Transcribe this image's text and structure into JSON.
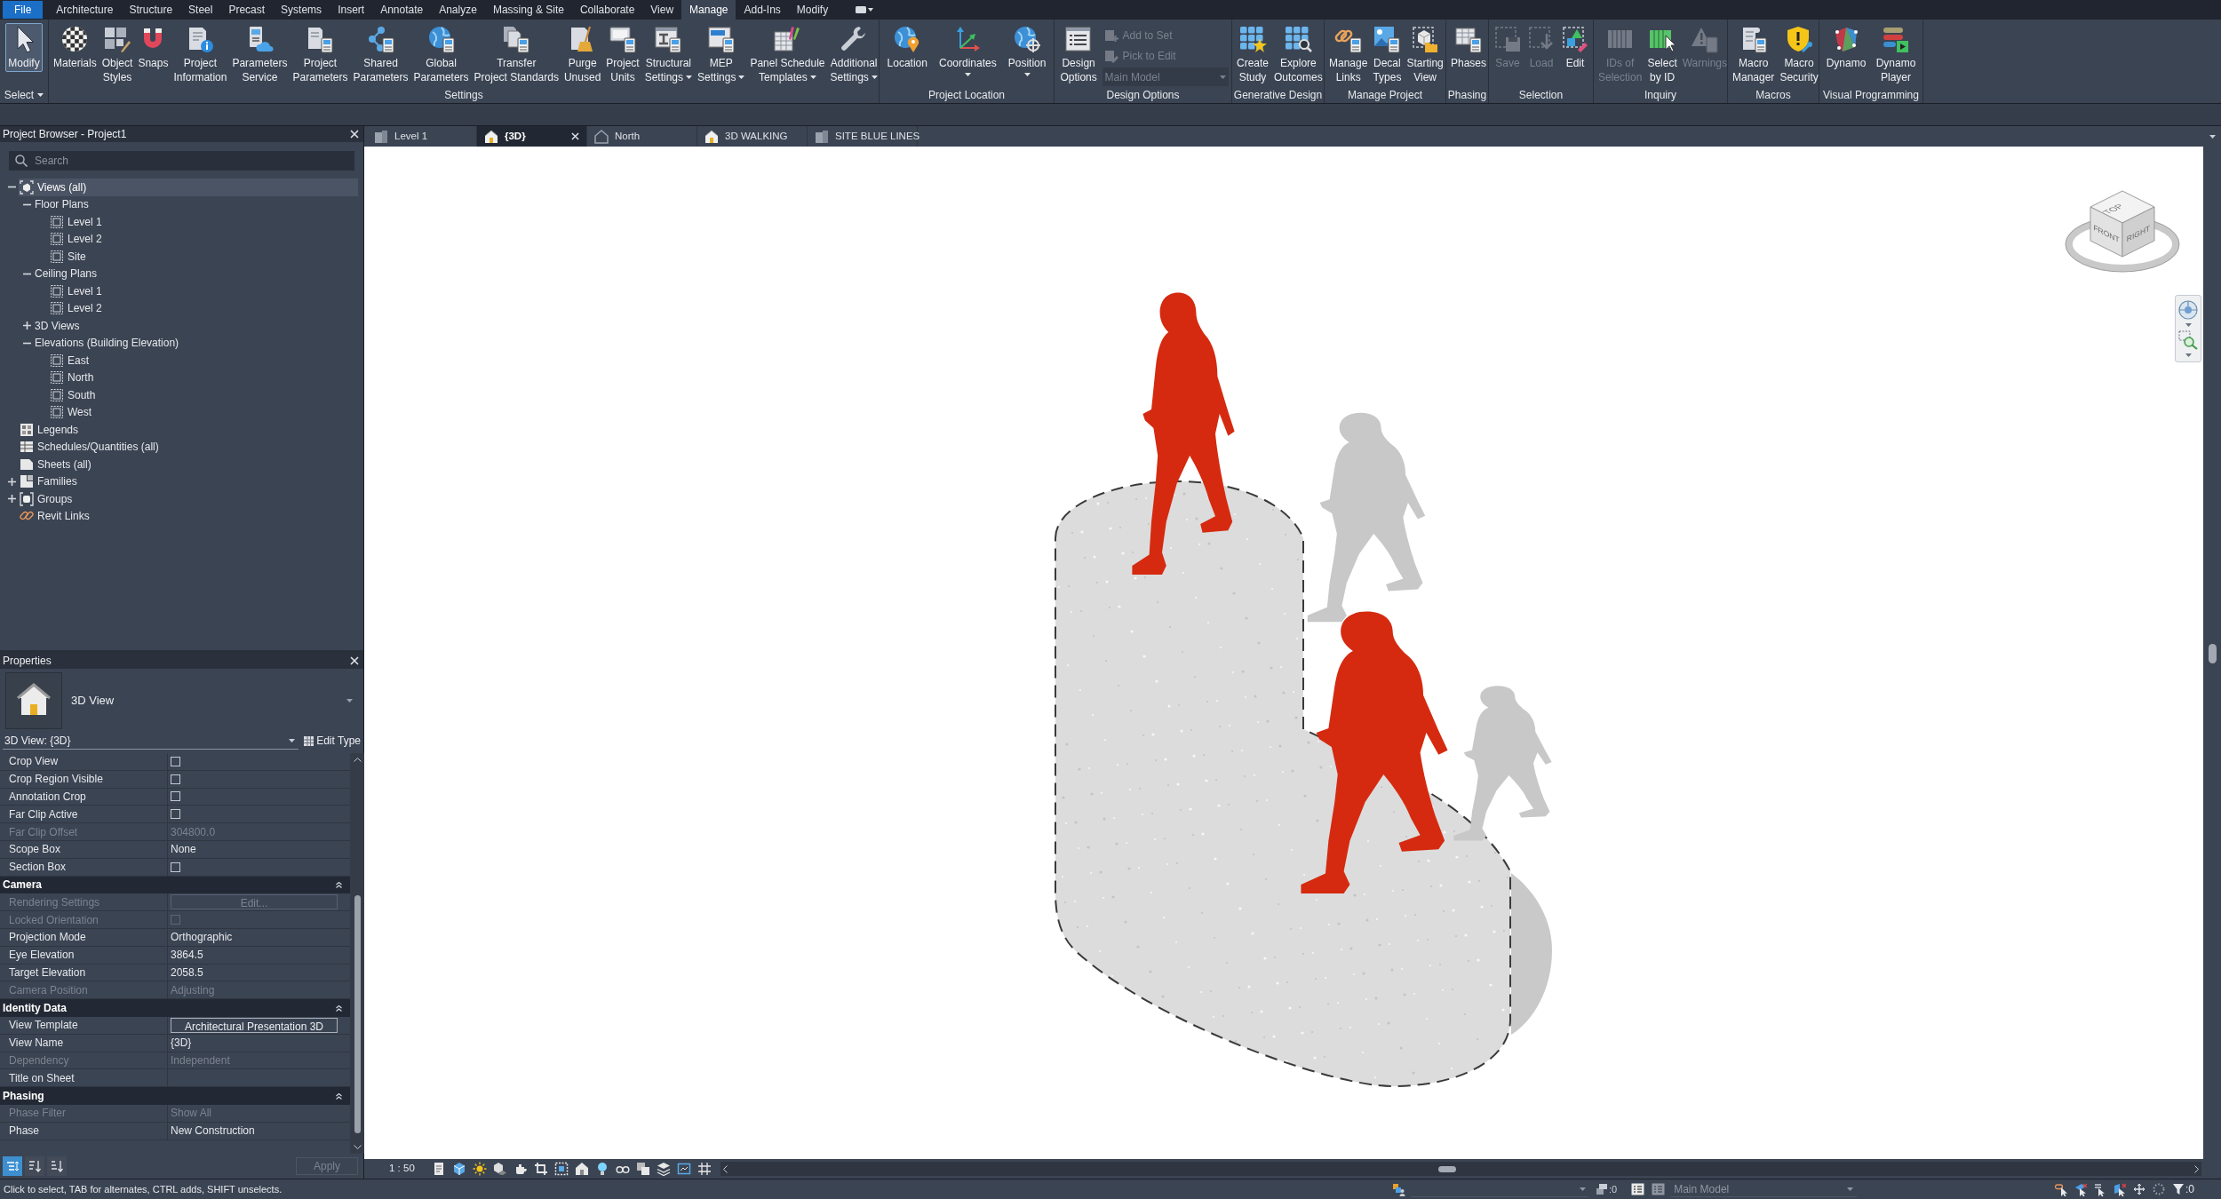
{
  "ribbon": {
    "tabs": [
      {
        "label": "File",
        "kind": "file",
        "selected": false
      },
      {
        "label": "Architecture",
        "kind": "tab",
        "selected": false
      },
      {
        "label": "Structure",
        "kind": "tab",
        "selected": false
      },
      {
        "label": "Steel",
        "kind": "tab",
        "selected": false
      },
      {
        "label": "Precast",
        "kind": "tab",
        "selected": false
      },
      {
        "label": "Systems",
        "kind": "tab",
        "selected": false
      },
      {
        "label": "Insert",
        "kind": "tab",
        "selected": false
      },
      {
        "label": "Annotate",
        "kind": "tab",
        "selected": false
      },
      {
        "label": "Analyze",
        "kind": "tab",
        "selected": false
      },
      {
        "label": "Massing & Site",
        "kind": "tab",
        "selected": false
      },
      {
        "label": "Collaborate",
        "kind": "tab",
        "selected": false
      },
      {
        "label": "View",
        "kind": "tab",
        "selected": false
      },
      {
        "label": "Manage",
        "kind": "tab",
        "selected": true
      },
      {
        "label": "Add-Ins",
        "kind": "tab",
        "selected": false
      },
      {
        "label": "Modify",
        "kind": "tab",
        "selected": false
      }
    ],
    "panels": [
      {
        "label": "Select",
        "dropdown": true,
        "tools": [
          {
            "kind": "large",
            "label_lines": [
              "Modify"
            ],
            "active": true,
            "disabled": false,
            "dropdown": false
          }
        ]
      },
      {
        "label": "Settings",
        "dropdown": false,
        "tools": [
          {
            "kind": "large",
            "label_lines": [
              "Materials"
            ],
            "active": false,
            "disabled": false,
            "dropdown": false
          },
          {
            "kind": "large",
            "label_lines": [
              "Object",
              "Styles"
            ],
            "active": false,
            "disabled": false,
            "dropdown": false
          },
          {
            "kind": "large",
            "label_lines": [
              "Snaps"
            ],
            "active": false,
            "disabled": false,
            "dropdown": false
          },
          {
            "kind": "large",
            "label_lines": [
              "Project",
              "Information"
            ],
            "active": false,
            "disabled": false,
            "dropdown": false
          },
          {
            "kind": "large",
            "label_lines": [
              "Parameters",
              "Service"
            ],
            "active": false,
            "disabled": false,
            "dropdown": false
          },
          {
            "kind": "large",
            "label_lines": [
              "Project",
              "Parameters"
            ],
            "active": false,
            "disabled": false,
            "dropdown": false
          },
          {
            "kind": "large",
            "label_lines": [
              "Shared",
              "Parameters"
            ],
            "active": false,
            "disabled": false,
            "dropdown": false
          },
          {
            "kind": "large",
            "label_lines": [
              "Global",
              "Parameters"
            ],
            "active": false,
            "disabled": false,
            "dropdown": false
          },
          {
            "kind": "large",
            "label_lines": [
              "Transfer",
              "Project Standards"
            ],
            "active": false,
            "disabled": false,
            "dropdown": false
          },
          {
            "kind": "large",
            "label_lines": [
              "Purge",
              "Unused"
            ],
            "active": false,
            "disabled": false,
            "dropdown": false
          },
          {
            "kind": "large",
            "label_lines": [
              "Project",
              "Units"
            ],
            "active": false,
            "disabled": false,
            "dropdown": false
          },
          {
            "kind": "large",
            "label_lines": [
              "Structural",
              "Settings"
            ],
            "active": false,
            "disabled": false,
            "dropdown": true
          },
          {
            "kind": "large",
            "label_lines": [
              "MEP",
              "Settings"
            ],
            "active": false,
            "disabled": false,
            "dropdown": true
          },
          {
            "kind": "large",
            "label_lines": [
              "Panel Schedule",
              "Templates"
            ],
            "active": false,
            "disabled": false,
            "dropdown": true
          },
          {
            "kind": "large",
            "label_lines": [
              "Additional",
              "Settings"
            ],
            "active": false,
            "disabled": false,
            "dropdown": true
          }
        ]
      },
      {
        "label": "Project Location",
        "dropdown": false,
        "tools": [
          {
            "kind": "large",
            "label_lines": [
              "Location"
            ],
            "active": false,
            "disabled": false,
            "dropdown": false
          },
          {
            "kind": "large",
            "label_lines": [
              "Coordinates"
            ],
            "active": false,
            "disabled": false,
            "dropdown": true
          },
          {
            "kind": "large",
            "label_lines": [
              "Position"
            ],
            "active": false,
            "disabled": false,
            "dropdown": true
          }
        ]
      },
      {
        "label": "Design Options",
        "dropdown": false,
        "tools": [
          {
            "kind": "large",
            "label_lines": [
              "Design",
              "Options"
            ],
            "active": false,
            "disabled": false,
            "dropdown": false
          },
          {
            "kind": "small",
            "label": "Add to Set",
            "disabled": true
          },
          {
            "kind": "small",
            "label": "Pick to Edit",
            "disabled": true
          },
          {
            "kind": "combo",
            "value": "Main Model",
            "disabled": true
          }
        ]
      },
      {
        "label": "Generative Design",
        "dropdown": false,
        "tools": [
          {
            "kind": "large",
            "label_lines": [
              "Create",
              "Study"
            ],
            "active": false,
            "disabled": false,
            "dropdown": false
          },
          {
            "kind": "large",
            "label_lines": [
              "Explore",
              "Outcomes"
            ],
            "active": false,
            "disabled": false,
            "dropdown": false
          }
        ]
      },
      {
        "label": "Manage Project",
        "dropdown": false,
        "tools": [
          {
            "kind": "large",
            "label_lines": [
              "Manage",
              "Links"
            ],
            "active": false,
            "disabled": false,
            "dropdown": false
          },
          {
            "kind": "large",
            "label_lines": [
              "Decal",
              "Types"
            ],
            "active": false,
            "disabled": false,
            "dropdown": false
          },
          {
            "kind": "large",
            "label_lines": [
              "Starting",
              "View"
            ],
            "active": false,
            "disabled": false,
            "dropdown": false
          }
        ]
      },
      {
        "label": "Phasing",
        "dropdown": false,
        "tools": [
          {
            "kind": "large",
            "label_lines": [
              "Phases"
            ],
            "active": false,
            "disabled": false,
            "dropdown": false
          }
        ]
      },
      {
        "label": "Selection",
        "dropdown": false,
        "tools": [
          {
            "kind": "large",
            "label_lines": [
              "Save"
            ],
            "active": false,
            "disabled": true,
            "dropdown": false
          },
          {
            "kind": "large",
            "label_lines": [
              "Load"
            ],
            "active": false,
            "disabled": true,
            "dropdown": false
          },
          {
            "kind": "large",
            "label_lines": [
              "Edit"
            ],
            "active": false,
            "disabled": false,
            "dropdown": false
          }
        ]
      },
      {
        "label": "Inquiry",
        "dropdown": false,
        "tools": [
          {
            "kind": "large",
            "label_lines": [
              "IDs of",
              "Selection"
            ],
            "active": false,
            "disabled": true,
            "dropdown": false
          },
          {
            "kind": "large",
            "label_lines": [
              "Select",
              "by ID"
            ],
            "active": false,
            "disabled": false,
            "dropdown": false
          },
          {
            "kind": "large",
            "label_lines": [
              "Warnings"
            ],
            "active": false,
            "disabled": true,
            "dropdown": false
          }
        ]
      },
      {
        "label": "Macros",
        "dropdown": false,
        "tools": [
          {
            "kind": "large",
            "label_lines": [
              "Macro",
              "Manager"
            ],
            "active": false,
            "disabled": false,
            "dropdown": false
          },
          {
            "kind": "large",
            "label_lines": [
              "Macro",
              "Security"
            ],
            "active": false,
            "disabled": false,
            "dropdown": false
          }
        ]
      },
      {
        "label": "Visual Programming",
        "dropdown": false,
        "tools": [
          {
            "kind": "large",
            "label_lines": [
              "Dynamo"
            ],
            "active": false,
            "disabled": false,
            "dropdown": false
          },
          {
            "kind": "large",
            "label_lines": [
              "Dynamo",
              "Player"
            ],
            "active": false,
            "disabled": false,
            "dropdown": false
          }
        ]
      }
    ]
  },
  "project_browser": {
    "title": "Project Browser - Project1",
    "search": {
      "placeholder": "Search"
    },
    "tree": [
      {
        "label": "Views (all)",
        "kind": "views",
        "expanded": true,
        "selected": true,
        "children": [
          {
            "label": "Floor Plans",
            "expanded": true,
            "selected": false,
            "children": [
              {
                "label": "Level 1",
                "kind": "view",
                "selected": false
              },
              {
                "label": "Level 2",
                "kind": "view",
                "selected": false
              },
              {
                "label": "Site",
                "kind": "view",
                "selected": false
              }
            ]
          },
          {
            "label": "Ceiling Plans",
            "expanded": true,
            "selected": false,
            "children": [
              {
                "label": "Level 1",
                "kind": "view",
                "selected": false
              },
              {
                "label": "Level 2",
                "kind": "view",
                "selected": false
              }
            ]
          },
          {
            "label": "3D Views",
            "expanded": false,
            "selected": false
          },
          {
            "label": "Elevations (Building Elevation)",
            "expanded": true,
            "selected": false,
            "children": [
              {
                "label": "East",
                "kind": "view",
                "selected": false
              },
              {
                "label": "North",
                "kind": "view",
                "selected": false
              },
              {
                "label": "South",
                "kind": "view",
                "selected": false
              },
              {
                "label": "West",
                "kind": "view",
                "selected": false
              }
            ]
          }
        ]
      },
      {
        "label": "Legends",
        "kind": "legends",
        "selected": false
      },
      {
        "label": "Schedules/Quantities (all)",
        "kind": "schedules",
        "selected": false
      },
      {
        "label": "Sheets (all)",
        "kind": "sheets",
        "selected": false
      },
      {
        "label": "Families",
        "kind": "families",
        "expanded": false,
        "selected": false
      },
      {
        "label": "Groups",
        "kind": "groups",
        "expanded": false,
        "selected": false
      },
      {
        "label": "Revit Links",
        "kind": "links",
        "selected": false
      }
    ]
  },
  "properties": {
    "title": "Properties",
    "type_name": "3D View",
    "instance": "3D View: {3D}",
    "edit_type": "Edit Type",
    "rows": [
      {
        "kind": "checkbox",
        "label": "Crop View",
        "checked": false,
        "disabled": false
      },
      {
        "kind": "checkbox",
        "label": "Crop Region Visible",
        "checked": false,
        "disabled": false
      },
      {
        "kind": "checkbox",
        "label": "Annotation Crop",
        "checked": false,
        "disabled": false
      },
      {
        "kind": "checkbox",
        "label": "Far Clip Active",
        "checked": false,
        "disabled": false
      },
      {
        "kind": "text",
        "label": "Far Clip Offset",
        "value": "304800.0",
        "disabled": true
      },
      {
        "kind": "text",
        "label": "Scope Box",
        "value": "None",
        "disabled": false
      },
      {
        "kind": "checkbox",
        "label": "Section Box",
        "checked": false,
        "disabled": false
      },
      {
        "kind": "group",
        "label": "Camera",
        "expanded": true
      },
      {
        "kind": "button",
        "label": "Rendering Settings",
        "value": "Edit...",
        "disabled": true
      },
      {
        "kind": "checkbox",
        "label": "Locked Orientation",
        "checked": false,
        "disabled": true
      },
      {
        "kind": "text",
        "label": "Projection Mode",
        "value": "Orthographic",
        "disabled": false
      },
      {
        "kind": "text",
        "label": "Eye Elevation",
        "value": "3864.5",
        "disabled": false
      },
      {
        "kind": "text",
        "label": "Target Elevation",
        "value": "2058.5",
        "disabled": false
      },
      {
        "kind": "text",
        "label": "Camera Position",
        "value": "Adjusting",
        "disabled": true
      },
      {
        "kind": "group",
        "label": "Identity Data",
        "expanded": true
      },
      {
        "kind": "button",
        "label": "View Template",
        "value": "Architectural Presentation 3D",
        "disabled": false
      },
      {
        "kind": "text",
        "label": "View Name",
        "value": "{3D}",
        "disabled": false
      },
      {
        "kind": "text",
        "label": "Dependency",
        "value": "Independent",
        "disabled": true
      },
      {
        "kind": "text",
        "label": "Title on Sheet",
        "disabled": false
      },
      {
        "kind": "group",
        "label": "Phasing",
        "expanded": true
      },
      {
        "kind": "text",
        "label": "Phase Filter",
        "value": "Show All",
        "disabled": true
      },
      {
        "kind": "text",
        "label": "Phase",
        "value": "New Construction",
        "disabled": false
      }
    ],
    "sort_buttons": [
      {
        "kind": "categorized",
        "selected": true
      },
      {
        "kind": "ascending",
        "selected": false
      },
      {
        "kind": "descending",
        "selected": false
      }
    ],
    "apply": {
      "label": "Apply",
      "disabled": true
    }
  },
  "view_tabs": [
    {
      "label": "Level 1",
      "kind": "plan",
      "selected": false
    },
    {
      "label": "{3D}",
      "kind": "model",
      "selected": true
    },
    {
      "label": "North",
      "kind": "elevation",
      "selected": false
    },
    {
      "label": "3D WALKING",
      "kind": "model",
      "selected": false
    },
    {
      "label": "SITE BLUE LINES",
      "kind": "plan",
      "selected": false
    }
  ],
  "canvas": {
    "view_cube": {
      "faces": [
        "TOP",
        "FRONT",
        "RIGHT"
      ]
    }
  },
  "view_control_bar": {
    "scale": "1 : 50"
  },
  "status_bar": {
    "message": "Click to select, TAB for alternates, CTRL adds, SHIFT unselects.",
    "editable_count": ":0",
    "design_option": "Main Model",
    "filter_count": ":0"
  }
}
